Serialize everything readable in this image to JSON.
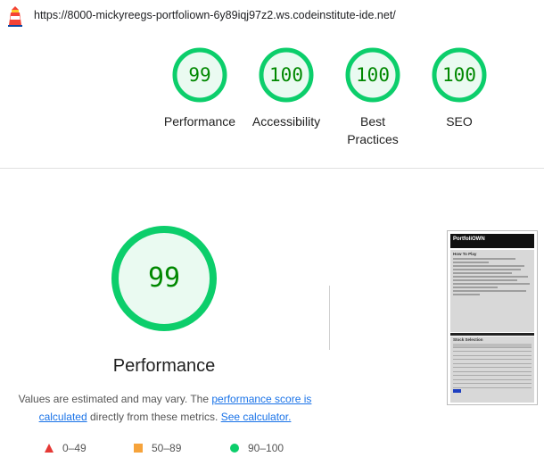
{
  "browser": {
    "url": "https://8000-mickyreegs-portfoliown-6y89iqj97z2.ws.codeinstitute-ide.net/"
  },
  "summary_gauges": [
    {
      "score": "99",
      "label": "Performance"
    },
    {
      "score": "100",
      "label": "Accessibility"
    },
    {
      "score": "100",
      "label": "Best Practices"
    },
    {
      "score": "100",
      "label": "SEO"
    }
  ],
  "performance": {
    "score": "99",
    "title": "Performance",
    "note_prefix": "Values are estimated and may vary. The ",
    "link_score": "performance score is calculated",
    "note_middle": " directly from these metrics. ",
    "link_calculator": "See calculator."
  },
  "legend": {
    "fail": "0–49",
    "average": "50–89",
    "pass": "90–100"
  },
  "thumbnail": {
    "logo": "PortfoliOWN",
    "section1_title": "How To Play",
    "section2_title": "Stock Selection"
  },
  "colors": {
    "pass": "#0cce6b",
    "pass_text": "#008800",
    "average": "#f6a33b",
    "fail": "#e53935",
    "link": "#1a73e8"
  }
}
